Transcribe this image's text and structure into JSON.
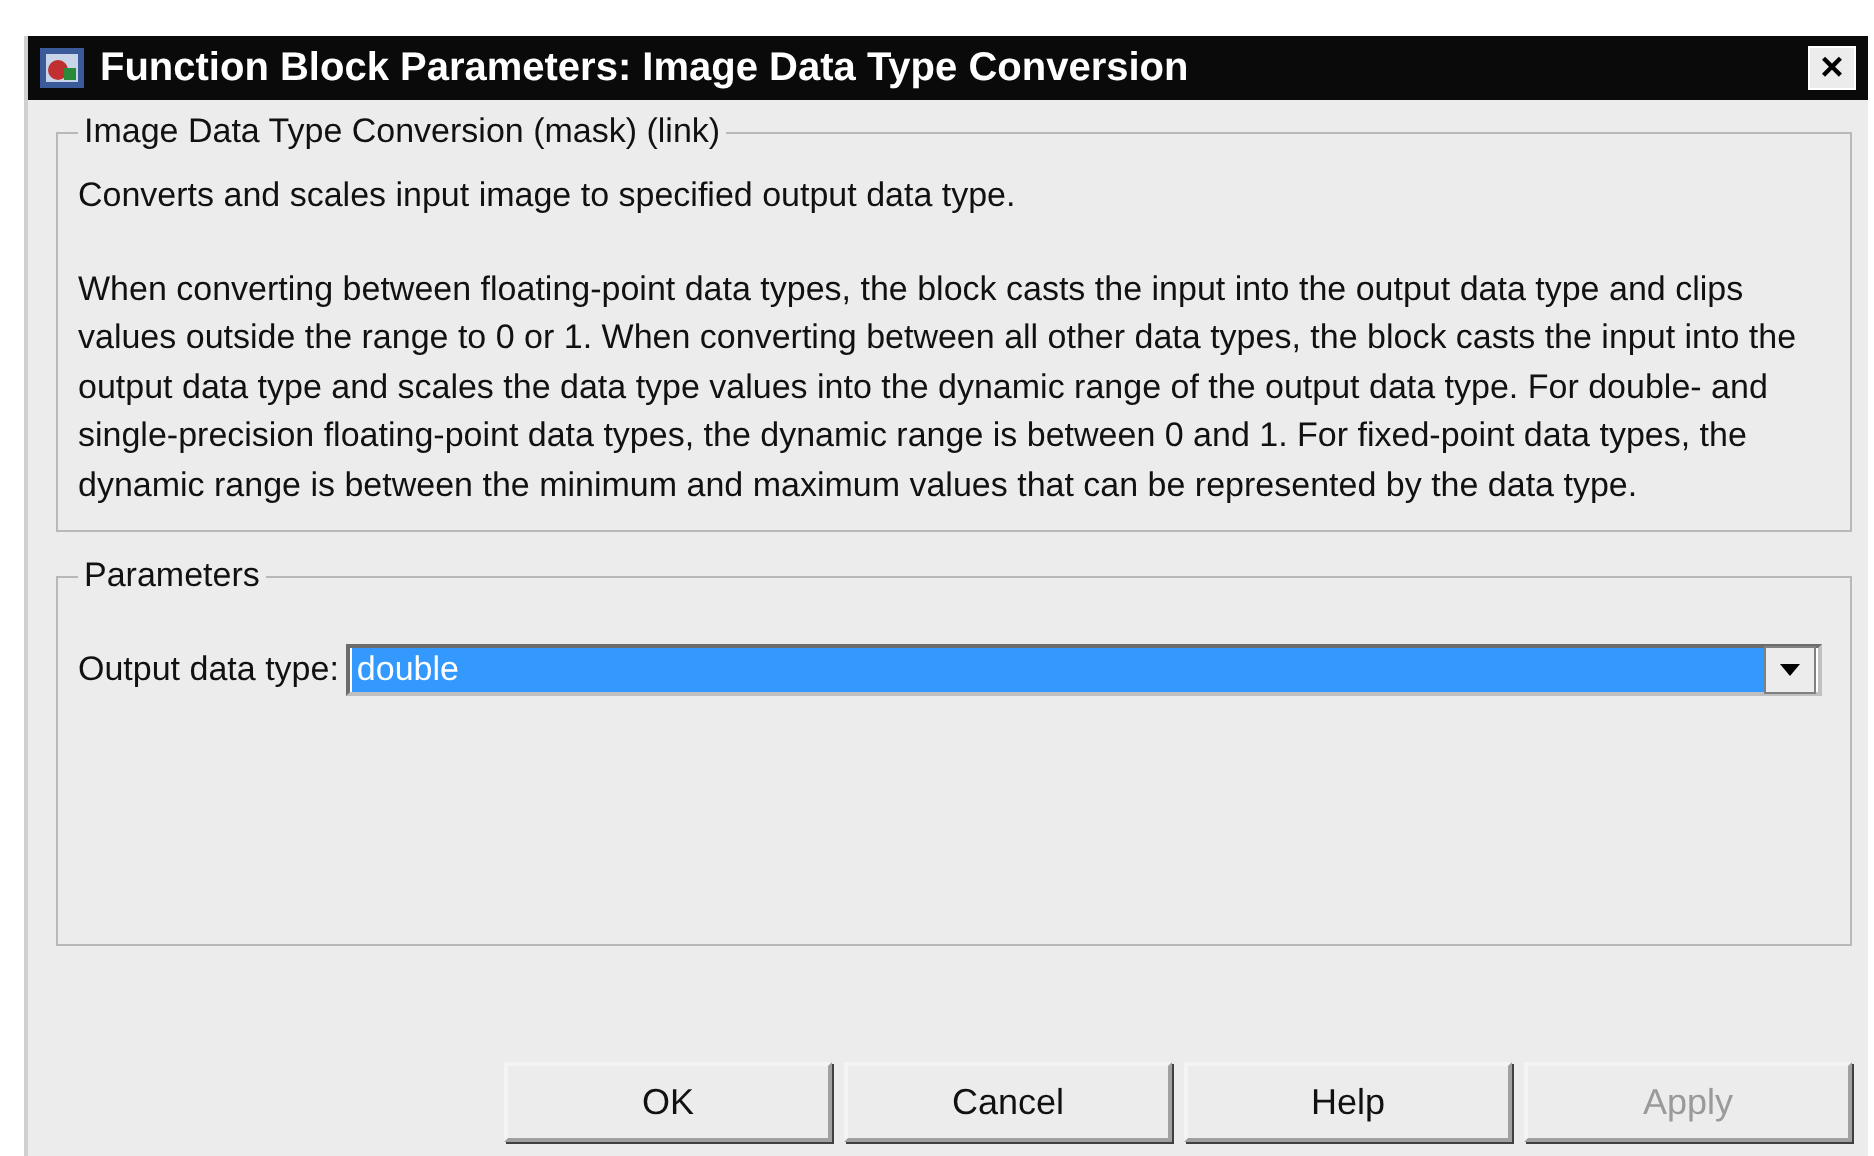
{
  "window": {
    "title": "Function Block Parameters: Image Data Type Conversion",
    "close": "×"
  },
  "description_group": {
    "title": "Image Data Type Conversion (mask) (link)",
    "paragraphs": [
      "Converts and scales input image to specified output data type.",
      "When converting between floating-point data types, the block casts the input into the output data type and clips values outside the range to 0 or 1. When converting between all other data types, the block casts the input into the output data type and scales the data type values into the dynamic range of the output data type. For double- and single-precision floating-point data types, the dynamic range is between 0 and 1. For fixed-point data types, the dynamic range is between the minimum and maximum values that can be represented by the data type."
    ]
  },
  "parameters_group": {
    "title": "Parameters",
    "fields": [
      {
        "label": "Output data type:",
        "value": "double",
        "selected": true
      }
    ]
  },
  "buttons": [
    {
      "label": "OK",
      "disabled": false
    },
    {
      "label": "Cancel",
      "disabled": false
    },
    {
      "label": "Help",
      "disabled": false
    },
    {
      "label": "Apply",
      "disabled": true
    }
  ]
}
